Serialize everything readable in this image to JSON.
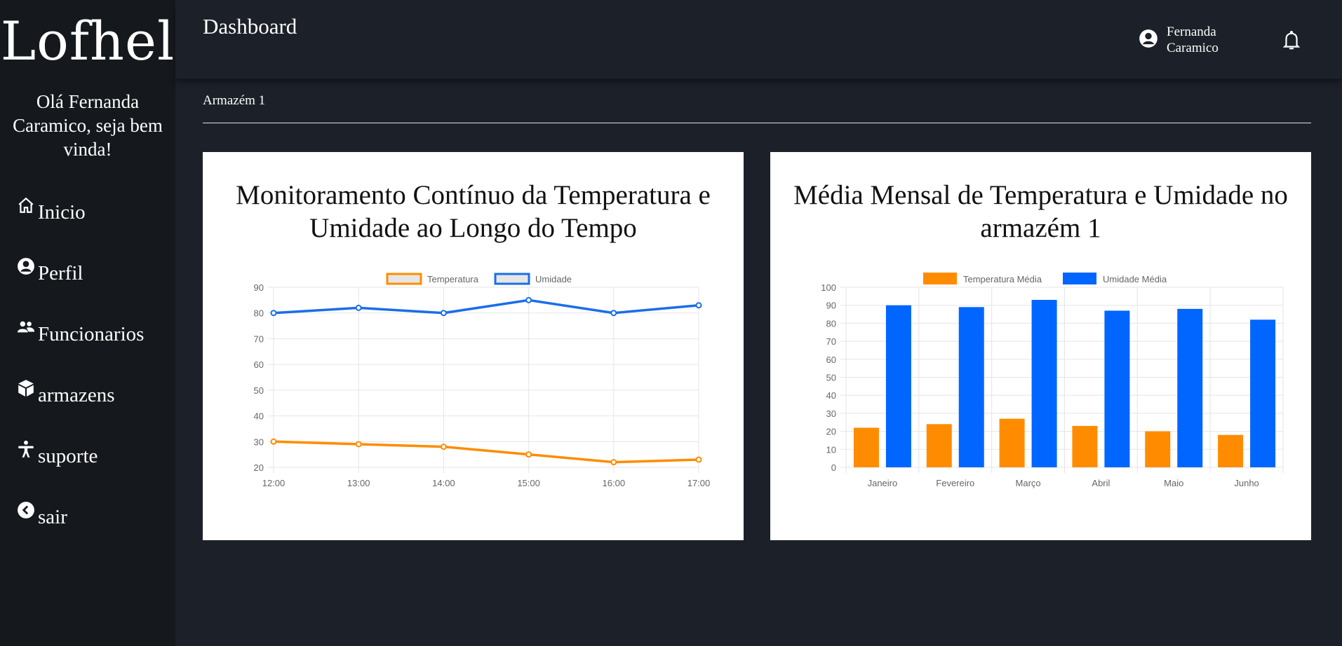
{
  "brand": {
    "logo_text": "Lofhel"
  },
  "sidebar": {
    "greeting": "Olá Fernanda Caramico, seja bem vinda!",
    "items": [
      {
        "label": "Inicio",
        "icon": "home-icon"
      },
      {
        "label": "Perfil",
        "icon": "user-circle-icon"
      },
      {
        "label": "Funcionarios",
        "icon": "users-icon"
      },
      {
        "label": "armazens",
        "icon": "box-icon"
      },
      {
        "label": "suporte",
        "icon": "accessibility-icon"
      },
      {
        "label": "sair",
        "icon": "chevron-left-circle-icon"
      }
    ]
  },
  "header": {
    "title": "Dashboard",
    "user_name": "Fernanda Caramico",
    "user_icon": "user-circle-icon",
    "notification_icon": "bell-icon"
  },
  "section": {
    "title": "Armazém 1"
  },
  "colors": {
    "orange": "#ff8c00",
    "blue": "#0066ff",
    "line_blue": "#1a6ee8",
    "sidebar_bg": "#15191e",
    "page_bg": "#1c2129"
  },
  "chart_data": [
    {
      "type": "line",
      "title": "Monitoramento Contínuo da Temperatura e Umidade ao Longo do Tempo",
      "categories": [
        "12:00",
        "13:00",
        "14:00",
        "15:00",
        "16:00",
        "17:00"
      ],
      "series": [
        {
          "name": "Temperatura",
          "values": [
            30,
            29,
            28,
            25,
            22,
            23
          ]
        },
        {
          "name": "Umidade",
          "values": [
            80,
            82,
            80,
            85,
            80,
            83
          ]
        }
      ],
      "ylim": [
        20,
        90
      ],
      "yticks": [
        20,
        30,
        40,
        50,
        60,
        70,
        80,
        90
      ],
      "legend": "top",
      "grid": true
    },
    {
      "type": "bar",
      "title": "Média Mensal de Temperatura e Umidade no armazém 1",
      "categories": [
        "Janeiro",
        "Fevereiro",
        "Março",
        "Abril",
        "Maio",
        "Junho"
      ],
      "series": [
        {
          "name": "Temperatura Média",
          "values": [
            22,
            24,
            27,
            23,
            20,
            18
          ]
        },
        {
          "name": "Umidade Média",
          "values": [
            90,
            89,
            93,
            87,
            88,
            82
          ]
        }
      ],
      "ylim": [
        0,
        100
      ],
      "yticks": [
        0,
        10,
        20,
        30,
        40,
        50,
        60,
        70,
        80,
        90,
        100
      ],
      "legend": "top",
      "grid": true
    }
  ]
}
